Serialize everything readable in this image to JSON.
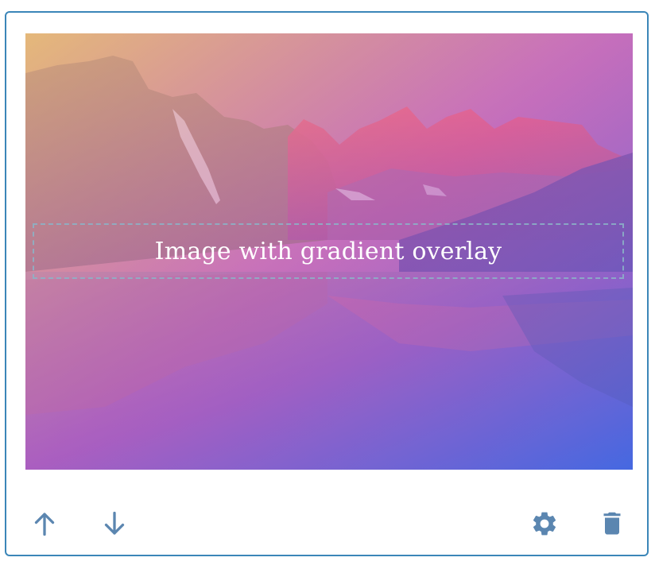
{
  "image_block": {
    "caption": "Image with gradient overlay",
    "image_description": "mountain-lake-landscape",
    "overlay_gradient": [
      "#f0c27b",
      "#c46ab9",
      "#7a4fd6",
      "#4a63e0"
    ]
  },
  "toolbar": {
    "move_up_icon": "arrow-up-icon",
    "move_down_icon": "arrow-down-icon",
    "settings_icon": "gear-icon",
    "delete_icon": "trash-icon",
    "icon_color": "#5b86b0"
  },
  "colors": {
    "card_border": "#3b86b8",
    "caption_text": "#ffffff"
  }
}
